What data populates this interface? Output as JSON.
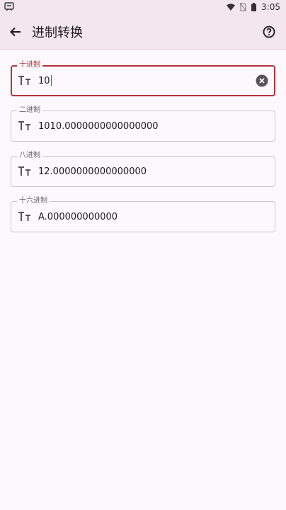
{
  "status_bar": {
    "time": "3:05",
    "left_icon": "notification-app-icon",
    "icons": [
      "wifi-icon",
      "no-sim-icon",
      "battery-icon"
    ]
  },
  "app_bar": {
    "title": "进制转换",
    "back_icon": "arrow-back-icon",
    "help_icon": "help-icon"
  },
  "fields": [
    {
      "label": "十进制",
      "value": "10",
      "focused": true
    },
    {
      "label": "二进制",
      "value": "1010.0000000000000000"
    },
    {
      "label": "八进制",
      "value": "12.0000000000000000"
    },
    {
      "label": "十六进制",
      "value": "A.000000000000"
    }
  ],
  "colors": {
    "accent": "#b4333f",
    "app_bar_bg": "#f3e6ec",
    "page_bg": "#fcf8fb"
  }
}
